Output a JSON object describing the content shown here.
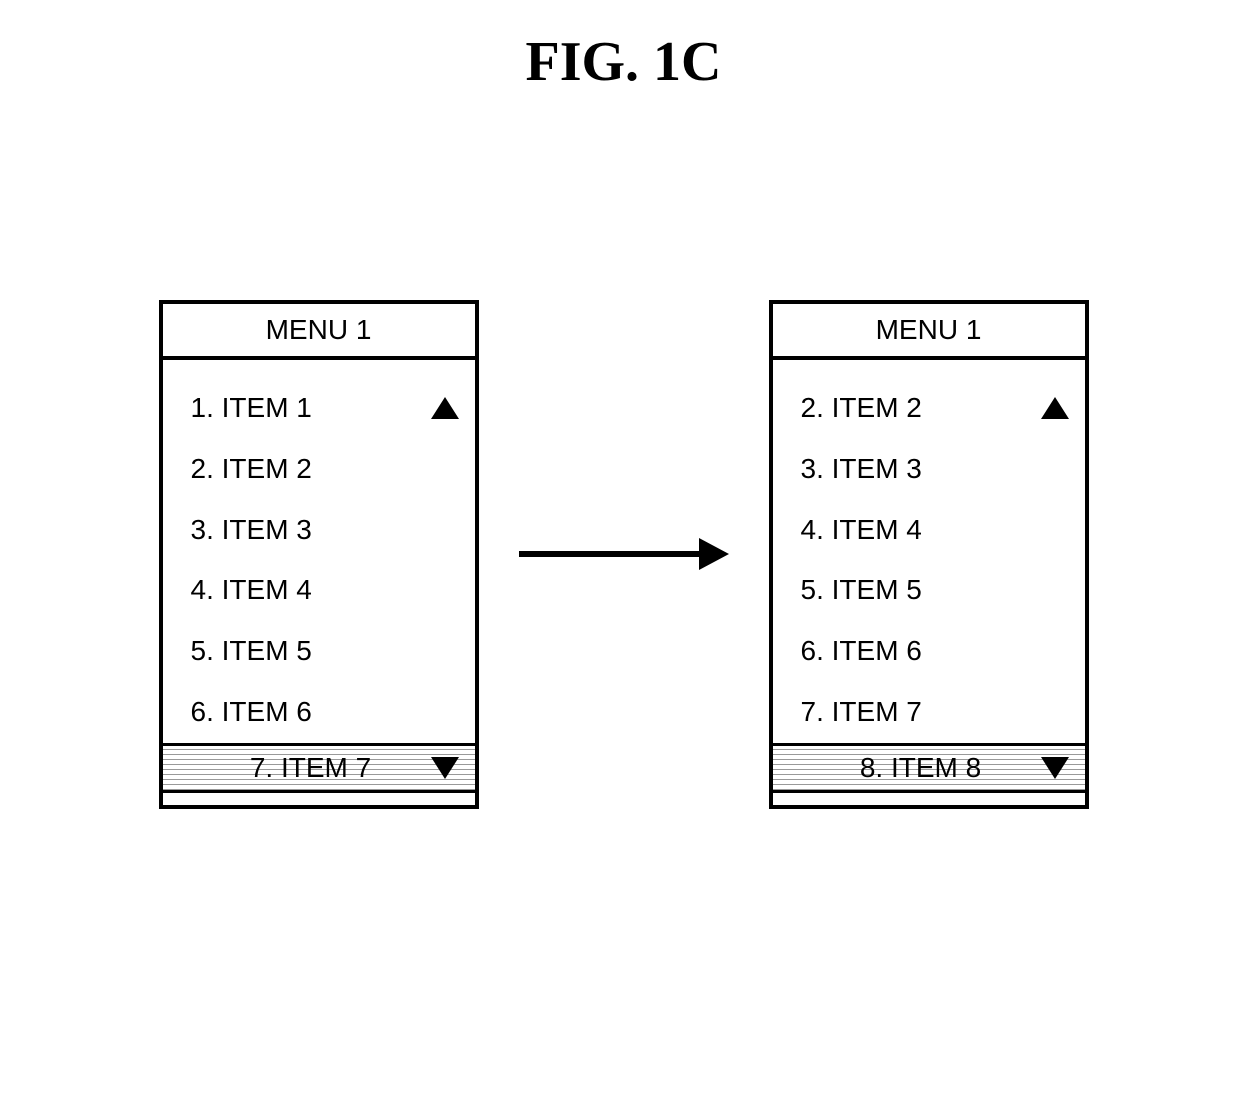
{
  "figure_title": "FIG. 1C",
  "left_menu": {
    "title": "MENU 1",
    "items": [
      "1. ITEM 1",
      "2. ITEM 2",
      "3. ITEM 3",
      "4. ITEM 4",
      "5. ITEM 5",
      "6. ITEM 6"
    ],
    "selected": "7. ITEM 7"
  },
  "right_menu": {
    "title": "MENU 1",
    "items": [
      "2. ITEM 2",
      "3. ITEM 3",
      "4. ITEM 4",
      "5. ITEM 5",
      "6. ITEM 6",
      "7. ITEM 7"
    ],
    "selected": "8. ITEM 8"
  }
}
